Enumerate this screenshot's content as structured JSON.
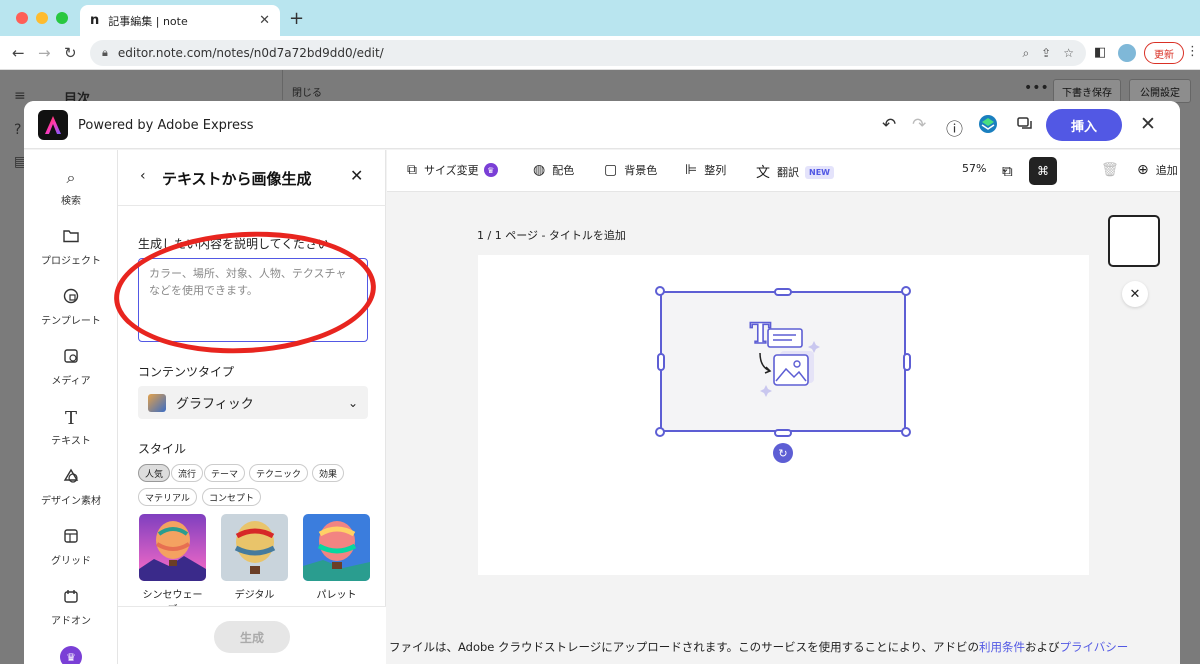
{
  "browser": {
    "tab_title": "記事編集 | note",
    "tab_favicon": "n",
    "url": "editor.note.com/notes/n0d7a72bd9dd0/edit/",
    "update_label": "更新"
  },
  "note_editor": {
    "toc_label": "目次",
    "close_label": "閉じる",
    "draft_label": "下書き保存",
    "publish_label": "公開設定"
  },
  "modal": {
    "powered_label": "Powered by Adobe Express",
    "insert_label": "挿入"
  },
  "rail": {
    "items": [
      {
        "label": "検索",
        "icon": "search-icon"
      },
      {
        "label": "プロジェクト",
        "icon": "folder-icon"
      },
      {
        "label": "テンプレート",
        "icon": "template-icon"
      },
      {
        "label": "メディア",
        "icon": "media-icon"
      },
      {
        "label": "テキスト",
        "icon": "text-icon"
      },
      {
        "label": "デザイン素材",
        "icon": "shapes-icon"
      },
      {
        "label": "グリッド",
        "icon": "grid-icon"
      },
      {
        "label": "アドオン",
        "icon": "addon-icon"
      }
    ]
  },
  "panel": {
    "title": "テキストから画像生成",
    "prompt_label": "生成したい内容を説明してください",
    "prompt_placeholder": "カラー、場所、対象、人物、テクスチャなどを使用できます。",
    "content_type_label": "コンテンツタイプ",
    "content_type_value": "グラフィック",
    "style_label": "スタイル",
    "chips": [
      "人気",
      "流行",
      "テーマ",
      "テクニック",
      "効果",
      "マテリアル",
      "コンセプト"
    ],
    "active_chip": "人気",
    "thumbs": [
      "シンセウェーブ",
      "デジタル",
      "パレット"
    ],
    "generate_label": "生成"
  },
  "canvas_toolbar": {
    "resize_label": "サイズ変更",
    "color_label": "配色",
    "bg_label": "背景色",
    "align_label": "整列",
    "translate_label": "翻訳",
    "new_badge": "NEW",
    "zoom": "57%",
    "add_label": "追加"
  },
  "canvas": {
    "page_label": "1 / 1 ページ - タイトルを追加"
  },
  "footer": {
    "text": "ファイルは、Adobe クラウドストレージにアップロードされます。このサービスを使用することにより、アドビの",
    "terms_link": "利用条件",
    "and": "および",
    "privacy_link": "プライバシー"
  },
  "colors": {
    "accent": "#5258e4",
    "annotation": "#e8251f",
    "tabbar": "#b9e5ef"
  }
}
